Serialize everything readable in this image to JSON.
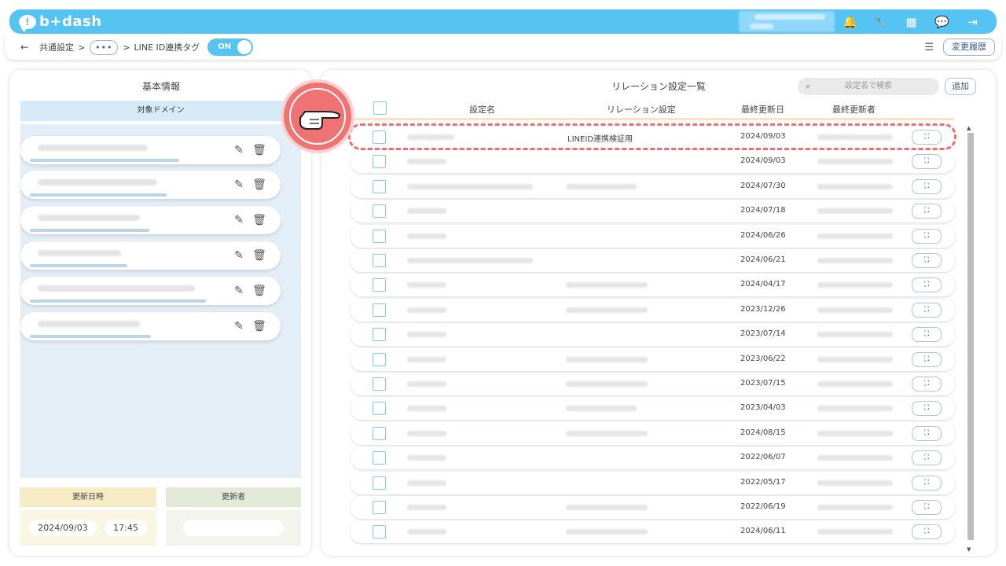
{
  "app": {
    "logo_text": "b+dash",
    "logo_mark": "!"
  },
  "header": {
    "icons": [
      "bell-icon",
      "wrench-icon",
      "grid-icon",
      "chat-icon",
      "logout-icon"
    ],
    "icon_glyphs": {
      "bell": "🔔",
      "wrench": "🔧",
      "grid": "▦",
      "chat": "💬",
      "logout": "⇥"
    }
  },
  "breadcrumb": {
    "back": "←",
    "items": [
      "共通設定",
      "LINE ID連携タグ"
    ],
    "sep": ">",
    "more": "•••",
    "toggle_label": "ON",
    "history_button": "変更履歴",
    "settings_glyph": "☰"
  },
  "left_panel": {
    "title": "基本情報",
    "domain_header": "対象ドメイン",
    "domains_count_shown": 6,
    "edit_glyph": "✎",
    "delete_glyph": "🗑",
    "updated_at_label": "更新日時",
    "updater_label": "更新者",
    "updated_date": "2024/09/03",
    "updated_time": "17:45"
  },
  "right_panel": {
    "title": "リレーション設定一覧",
    "search_placeholder": "設定名で検索",
    "add_button": "追加",
    "columns": [
      "設定名",
      "リレーション設定",
      "最終更新日",
      "最終更新者"
    ],
    "expand_glyph": "⛶",
    "rows": [
      {
        "date": "2024/09/03",
        "relation": "LINEID連携検証用"
      },
      {
        "date": "2024/09/03",
        "relation": ""
      },
      {
        "date": "2024/07/30",
        "relation": ""
      },
      {
        "date": "2024/07/18",
        "relation": ""
      },
      {
        "date": "2024/06/26",
        "relation": ""
      },
      {
        "date": "2024/06/21",
        "relation": ""
      },
      {
        "date": "2024/04/17",
        "relation": ""
      },
      {
        "date": "2023/12/26",
        "relation": ""
      },
      {
        "date": "2023/07/14",
        "relation": ""
      },
      {
        "date": "2023/06/22",
        "relation": ""
      },
      {
        "date": "2023/07/15",
        "relation": ""
      },
      {
        "date": "2023/04/03",
        "relation": ""
      },
      {
        "date": "2024/08/15",
        "relation": ""
      },
      {
        "date": "2022/06/07",
        "relation": ""
      },
      {
        "date": "2022/05/17",
        "relation": ""
      },
      {
        "date": "2022/06/19",
        "relation": ""
      },
      {
        "date": "2024/06/11",
        "relation": ""
      }
    ]
  },
  "colors": {
    "accent": "#55c4f3",
    "highlight": "#ee7171"
  }
}
